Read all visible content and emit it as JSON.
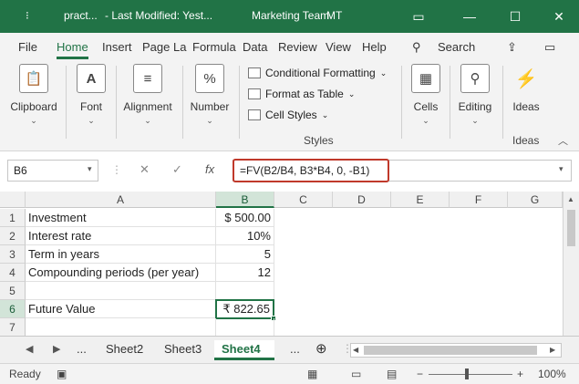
{
  "titlebar": {
    "file_name": "pract...",
    "last_modified": "-  Last Modified: Yest...",
    "team": "Marketing Team",
    "initials": "MT",
    "minimize": "—",
    "restore": "☐",
    "close": "✕"
  },
  "ribbon_tabs": [
    "File",
    "Home",
    "Insert",
    "Page La",
    "Formula",
    "Data",
    "Review",
    "View",
    "Help"
  ],
  "search_label": "Search",
  "ribbon": {
    "clipboard": "Clipboard",
    "font": "Font",
    "font_icon": "A",
    "alignment": "Alignment",
    "number": "Number",
    "number_icon": "%",
    "conditional_formatting": "Conditional Formatting",
    "format_as_table": "Format as Table",
    "cell_styles": "Cell Styles",
    "styles_group": "Styles",
    "cells": "Cells",
    "editing": "Editing",
    "ideas": "Ideas",
    "ideas_group": "Ideas"
  },
  "formula_bar": {
    "name_box": "B6",
    "formula": "=FV(B2/B4, B3*B4, 0, -B1)",
    "fx": "fx",
    "cancel": "✕",
    "enter": "✓"
  },
  "columns": [
    "A",
    "B",
    "C",
    "D",
    "E",
    "F",
    "G"
  ],
  "rows": [
    {
      "num": "1",
      "a": "Investment",
      "b": "$ 500.00"
    },
    {
      "num": "2",
      "a": "Interest rate",
      "b": "10%"
    },
    {
      "num": "3",
      "a": "Term in years",
      "b": "5"
    },
    {
      "num": "4",
      "a": "Compounding periods (per year)",
      "b": "12"
    },
    {
      "num": "5",
      "a": "",
      "b": ""
    },
    {
      "num": "6",
      "a": "Future Value",
      "b": "₹ 822.65"
    },
    {
      "num": "7",
      "a": "",
      "b": ""
    }
  ],
  "sheets": {
    "ellipsis": "...",
    "tabs": [
      "Sheet2",
      "Sheet3",
      "Sheet4"
    ],
    "active": "Sheet4",
    "add": "⊕"
  },
  "statusbar": {
    "ready": "Ready",
    "zoom": "100%",
    "minus": "−",
    "plus": "+"
  }
}
